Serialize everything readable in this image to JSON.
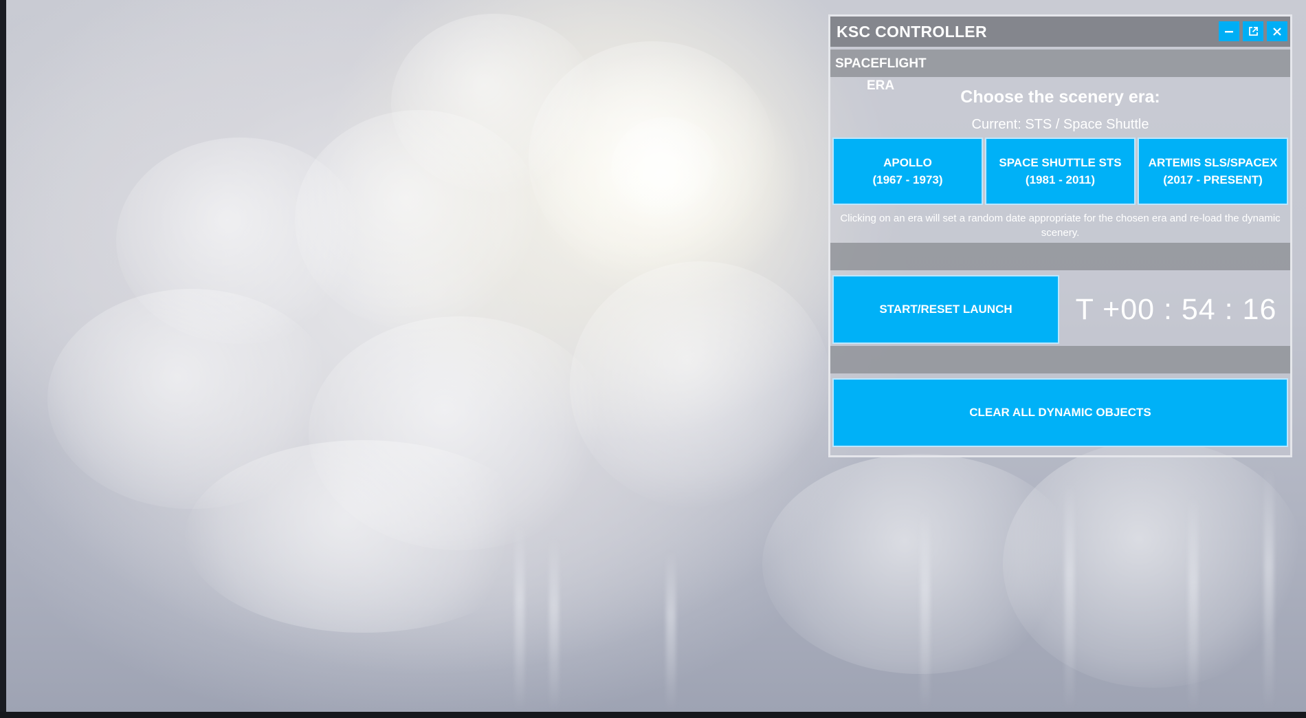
{
  "window": {
    "title": "KSC CONTROLLER",
    "buttons": [
      {
        "name": "minimize-button",
        "icon": "minimize-icon"
      },
      {
        "name": "popout-button",
        "icon": "external-window-icon"
      },
      {
        "name": "close-button",
        "icon": "close-icon"
      }
    ]
  },
  "section": {
    "label_line1": "SPACEFLIGHT",
    "label_line2": "ERA"
  },
  "era": {
    "heading": "Choose the scenery era:",
    "current": "Current: STS / Space Shuttle",
    "options": [
      {
        "line1": "APOLLO",
        "line2": "(1967 - 1973)"
      },
      {
        "line1": "SPACE SHUTTLE STS",
        "line2": "(1981 - 2011)"
      },
      {
        "line1": "ARTEMIS SLS/SPACEX",
        "line2": "(2017 - PRESENT)"
      }
    ],
    "note": "Clicking on an era will set a random date appropriate for the chosen era and re-load the dynamic scenery."
  },
  "launch": {
    "button_label": "START/RESET LAUNCH",
    "timer": "T +00 : 54 : 16"
  },
  "clear": {
    "button_label": "CLEAR ALL DYNAMIC OBJECTS"
  },
  "colors": {
    "accent": "#00b1f7",
    "titlebar": "#787a80",
    "text": "#ffffff"
  }
}
